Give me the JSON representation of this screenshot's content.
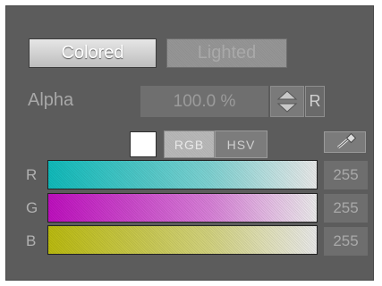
{
  "buttons": {
    "colored_label": "Colored",
    "lighted_label": "Lighted"
  },
  "alpha": {
    "label": "Alpha",
    "value": "100.0 %",
    "reset_label": "R"
  },
  "mode": {
    "rgb_label": "RGB",
    "hsv_label": "HSV",
    "selected": "RGB"
  },
  "swatch_color": "#ffffff",
  "channels": [
    {
      "label": "R",
      "value": "255",
      "color": "#10bcbc"
    },
    {
      "label": "G",
      "value": "255",
      "color": "#c010c0"
    },
    {
      "label": "B",
      "value": "255",
      "color": "#bcbc10"
    }
  ],
  "icons": {
    "picker": "eyedropper-icon",
    "spin": "spin-arrows-icon"
  }
}
